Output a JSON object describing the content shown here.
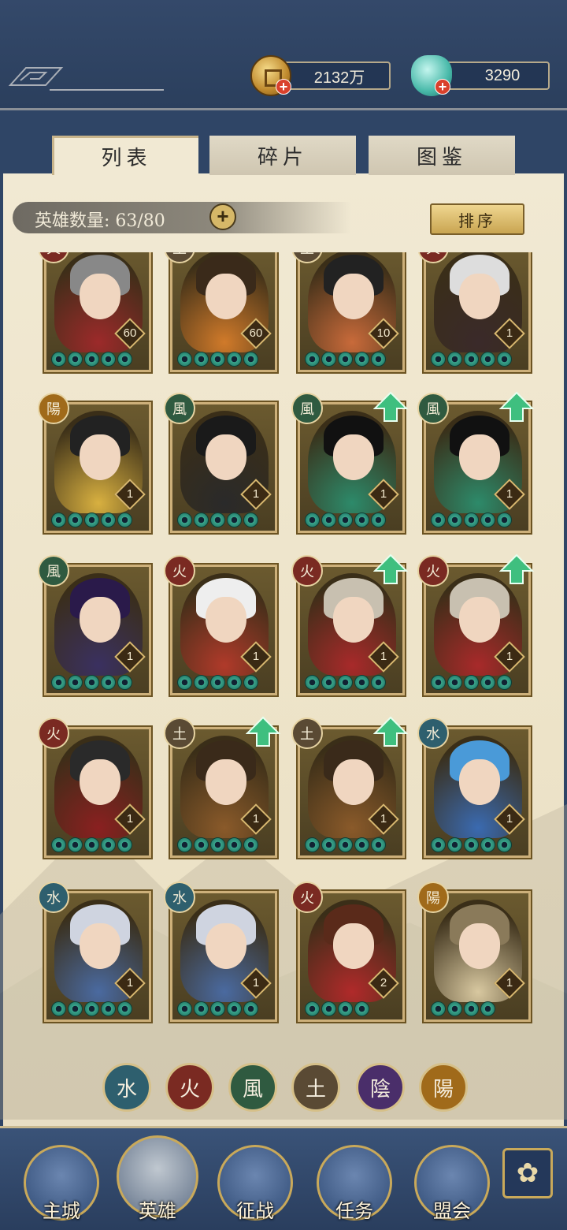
{
  "currency": {
    "gold_amount": "2132万",
    "jade_amount": "3290",
    "plus_symbol": "+"
  },
  "tabs": [
    {
      "label": "列表",
      "active": true
    },
    {
      "label": "碎片",
      "active": false
    },
    {
      "label": "图鉴",
      "active": false
    }
  ],
  "hero_count": {
    "label": "英雄数量: 63/80",
    "plus_symbol": "+"
  },
  "sort_label": "排序",
  "heroes": [
    {
      "element": "火",
      "level": "60",
      "stars": 5,
      "upgrade": false
    },
    {
      "element": "土",
      "level": "60",
      "stars": 5,
      "upgrade": false
    },
    {
      "element": "土",
      "level": "10",
      "stars": 5,
      "upgrade": false
    },
    {
      "element": "火",
      "level": "1",
      "stars": 5,
      "upgrade": false
    },
    {
      "element": "陽",
      "level": "1",
      "stars": 5,
      "upgrade": false
    },
    {
      "element": "風",
      "level": "1",
      "stars": 5,
      "upgrade": false
    },
    {
      "element": "風",
      "level": "1",
      "stars": 5,
      "upgrade": true
    },
    {
      "element": "風",
      "level": "1",
      "stars": 5,
      "upgrade": true
    },
    {
      "element": "風",
      "level": "1",
      "stars": 5,
      "upgrade": false
    },
    {
      "element": "火",
      "level": "1",
      "stars": 5,
      "upgrade": false
    },
    {
      "element": "火",
      "level": "1",
      "stars": 5,
      "upgrade": true
    },
    {
      "element": "火",
      "level": "1",
      "stars": 5,
      "upgrade": true
    },
    {
      "element": "火",
      "level": "1",
      "stars": 5,
      "upgrade": false
    },
    {
      "element": "土",
      "level": "1",
      "stars": 5,
      "upgrade": true
    },
    {
      "element": "土",
      "level": "1",
      "stars": 5,
      "upgrade": true
    },
    {
      "element": "水",
      "level": "1",
      "stars": 5,
      "upgrade": false
    },
    {
      "element": "水",
      "level": "1",
      "stars": 5,
      "upgrade": false
    },
    {
      "element": "水",
      "level": "1",
      "stars": 5,
      "upgrade": false
    },
    {
      "element": "火",
      "level": "2",
      "stars": 4,
      "upgrade": false
    },
    {
      "element": "陽",
      "level": "1",
      "stars": 4,
      "upgrade": false
    }
  ],
  "element_filters": [
    {
      "glyph": "水",
      "color": "#2e5f6e"
    },
    {
      "glyph": "火",
      "color": "#7a2a22"
    },
    {
      "glyph": "風",
      "color": "#2f5a40"
    },
    {
      "glyph": "土",
      "color": "#5a4a34"
    },
    {
      "glyph": "陰",
      "color": "#4a2e6a"
    },
    {
      "glyph": "陽",
      "color": "#a06a1a"
    }
  ],
  "nav": [
    {
      "label": "主城",
      "icon": "city-gate-icon",
      "active": false
    },
    {
      "label": "英雄",
      "icon": "hero-portrait-icon",
      "active": true
    },
    {
      "label": "征战",
      "icon": "drum-icon",
      "active": false
    },
    {
      "label": "任务",
      "icon": "scroll-icon",
      "active": false
    },
    {
      "label": "盟会",
      "icon": "pavilion-icon",
      "active": false
    }
  ],
  "more_icon": "pattern-menu-icon"
}
